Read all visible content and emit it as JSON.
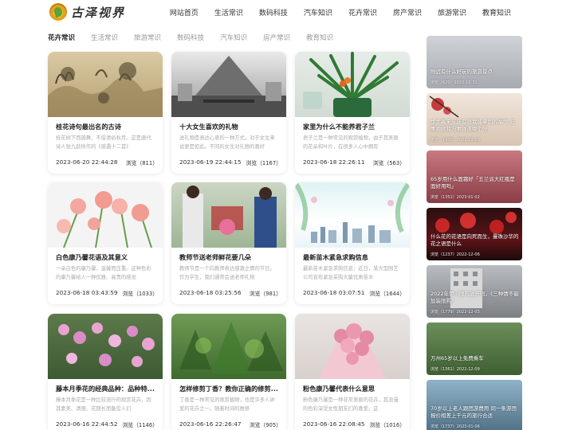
{
  "site": {
    "logo_text": "古泽视界"
  },
  "nav": [
    "网站首页",
    "生活常识",
    "数码科技",
    "汽车知识",
    "花卉常识",
    "房产常识",
    "旅游常识",
    "教育知识"
  ],
  "tabs": [
    "花卉常识",
    "生活常识",
    "旅游常识",
    "数码科技",
    "汽车知识",
    "房产常识",
    "教育知识"
  ],
  "cards": [
    {
      "title": "桂花诗句最出名的古诗",
      "desc": "桂花树下西施舞，不借清俗秋月。这是唐代诗人张九龄所作的《感遇十二首》",
      "date": "2023-06-20 22:44:28",
      "views": "浏览（811）"
    },
    {
      "title": "十大女生喜欢的礼物",
      "desc": "送礼物是表达心意的一种方式，对于女生来说更是如此。不同的女生对礼物的喜好",
      "date": "2023-06-19 22:44:15",
      "views": "浏览（1167）"
    },
    {
      "title": "家里为什么不能养君子兰",
      "desc": "君子兰是一种常见的观赏植物，由于其美丽的花朵和叶片，在很多人心中拥有",
      "date": "2023-06-18 22:26:11",
      "views": "浏览（563）"
    },
    {
      "title": "白色康乃馨花语及其意义",
      "desc": "一朵白色的康乃馨，温馨而庄重。这种色彩的康乃馨给人一种优雅、高贵的感觉",
      "date": "2023-06-18 03:43:59",
      "views": "浏览（1033）"
    },
    {
      "title": "教师节送老师鲜花要几朵",
      "desc": "教师节是一个向教师表达感激之情的节日。作为学生，我们通常会送老师礼物",
      "date": "2023-06-18 03:25:56",
      "views": "浏览（981）"
    },
    {
      "title": "最新苗木紧急求购信息",
      "desc": "最新苗木紧急求购信息：近日，某大型园艺公司宣布紧急采购大量优质苗木",
      "date": "2023-06-18 03:07:51",
      "views": "浏览（1644）"
    },
    {
      "title": "藤本月季花的经典品种：品种特...",
      "desc": "藤本月季花是一种比较流行的观赏花卉，因其素美、清丽、花期长而备受人们",
      "date": "2023-06-16 22:44:52",
      "views": "浏览（1146）"
    },
    {
      "title": "怎样修剪丁香？教你正确的修剪...",
      "desc": "丁香是一种常见的观赏植物，也是许多人钟爱的花卉之一。随着时间的推移",
      "date": "2023-06-16 22:26:47",
      "views": "浏览（905）"
    },
    {
      "title": "粉色康乃馨代表什么意思",
      "desc": "粉色康乃馨是一种非常美丽的花卉，其浪漫的色彩深受女性朋友们的喜爱。这",
      "date": "2023-06-16 22:08:45",
      "views": "浏览（1016）"
    }
  ],
  "sidebar": [
    {
      "caption": "附近有什么好玩的旅游景点",
      "meta": "浏览（620）2022-10-31"
    },
    {
      "caption": "步步高来年年有钱我能拿到的福气 万事顺顺和万事顺遂哪个好",
      "meta": "浏览（1430）2022-12-13"
    },
    {
      "caption": "65岁用什么面霜好「五兰派大红瓶是面好用吗」",
      "meta": "浏览（1351）2023-01-02"
    },
    {
      "caption": "什么花的花语是向死而生，曼珠沙华的花之语是什么",
      "meta": "浏览（1237）2022-12-06"
    },
    {
      "caption": "2022年伊川限购放开吗，《三种情不能加装限购》",
      "meta": "浏览（1779）2022-12-03"
    },
    {
      "caption": "万州65岁以上免费乘车",
      "meta": "浏览（1361）2022-12-09"
    },
    {
      "caption": "70岁以上老人跟团游费用 同一条游团报价相差上千元的旅行合适",
      "meta": "浏览（1737）2023-01-06"
    }
  ],
  "colors": {
    "accent": "#222222",
    "muted": "#999999"
  }
}
